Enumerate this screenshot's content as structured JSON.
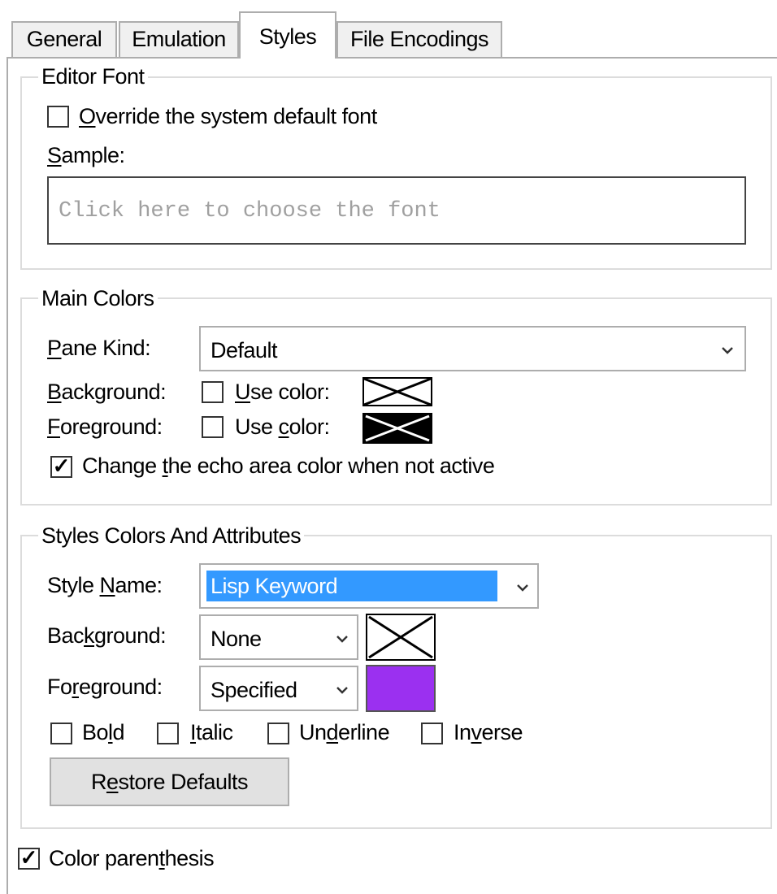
{
  "tabs": [
    {
      "label": "General"
    },
    {
      "label": "Emulation"
    },
    {
      "label": "Styles"
    },
    {
      "label": "File Encodings"
    }
  ],
  "editor_font": {
    "title": "Editor Font",
    "override": {
      "label_pre": "",
      "label_u": "O",
      "label_post": "verride the system default font",
      "checked": false
    },
    "sample": {
      "label_u": "S",
      "label_post": "ample:",
      "placeholder": "Click here to choose the font"
    }
  },
  "main_colors": {
    "title": "Main Colors",
    "pane_kind": {
      "label_u": "P",
      "label_post": "ane Kind:",
      "value": "Default"
    },
    "background": {
      "label_u": "B",
      "label_post": "ackground:",
      "use_u": "U",
      "use_post": "se color:",
      "checked": false
    },
    "foreground": {
      "label_u": "F",
      "label_post": "oreground:",
      "use_pre": "Use ",
      "use_u": "c",
      "use_post": "olor:",
      "checked": false
    },
    "echo": {
      "label_pre": "Change ",
      "label_u": "t",
      "label_post": "he echo area color when not active",
      "checked": true
    }
  },
  "styles_colors": {
    "title": "Styles Colors And Attributes",
    "style_name": {
      "label_pre": "Style ",
      "label_u": "N",
      "label_post": "ame:",
      "value": "Lisp Keyword"
    },
    "background": {
      "label_pre": "Bac",
      "label_u": "k",
      "label_post": "ground:",
      "value": "None"
    },
    "foreground": {
      "label_pre": "Fo",
      "label_u": "r",
      "label_post": "eground:",
      "value": "Specified",
      "color": "#9b30f0"
    },
    "bold": {
      "label_pre": "Bo",
      "label_u": "l",
      "label_post": "d",
      "checked": false
    },
    "italic": {
      "label_pre": "",
      "label_u": "I",
      "label_post": "talic",
      "checked": false
    },
    "underline": {
      "label_pre": "Un",
      "label_u": "d",
      "label_post": "erline",
      "checked": false
    },
    "inverse": {
      "label_pre": "In",
      "label_u": "v",
      "label_post": "erse",
      "checked": false
    },
    "restore": {
      "label_pre": "R",
      "label_u": "e",
      "label_post": "store Defaults"
    }
  },
  "color_parenthesis": {
    "label_pre": "Color paren",
    "label_u": "t",
    "label_post": "hesis",
    "checked": true
  },
  "colors": {
    "selection": "#3399ff",
    "purple": "#9b30f0"
  }
}
